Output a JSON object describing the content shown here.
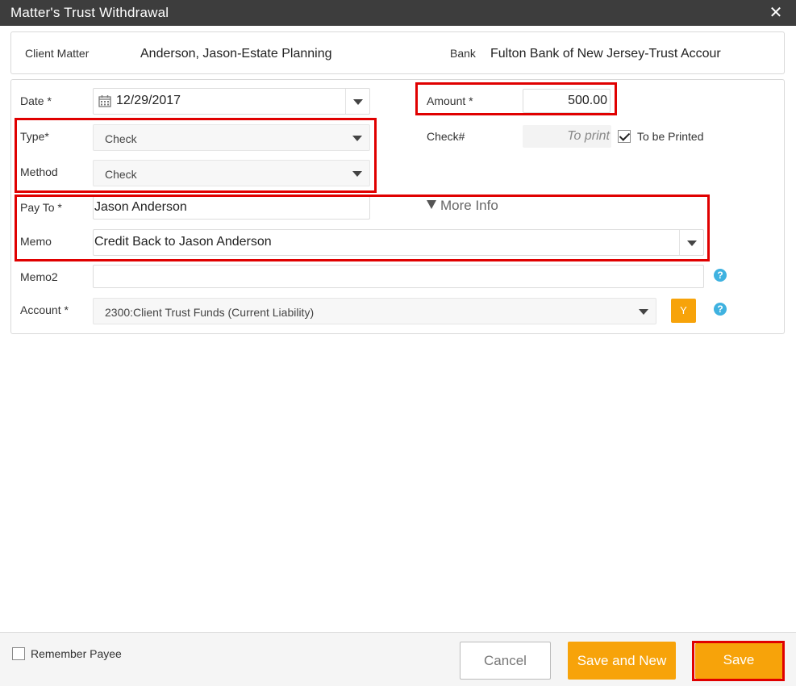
{
  "window": {
    "title": "Matter's Trust Withdrawal",
    "close_glyph": "✕"
  },
  "header": {
    "client_matter_label": "Client Matter",
    "client_matter_value": "Anderson, Jason-Estate Planning",
    "bank_label": "Bank",
    "bank_value": "Fulton Bank of New Jersey-Trust Accour"
  },
  "form": {
    "date_label": "Date *",
    "date_value": "12/29/2017",
    "amount_label": "Amount *",
    "amount_value": "500.00",
    "type_label": "Type*",
    "type_value": "Check",
    "check_label": "Check#",
    "check_placeholder": "To print",
    "to_be_printed_label": "To be Printed",
    "to_be_printed_checked": true,
    "method_label": "Method",
    "method_value": "Check",
    "payto_label": "Pay To *",
    "payto_value": "Jason Anderson",
    "more_info_label": "More Info",
    "memo_label": "Memo",
    "memo_value": "Credit Back to Jason Anderson",
    "memo2_label": "Memo2",
    "memo2_value": "",
    "account_label": "Account *",
    "account_value": "2300:Client Trust Funds (Current Liability)",
    "account_button_label": "Y",
    "help_glyph": "?"
  },
  "footer": {
    "remember_payee_label": "Remember Payee",
    "remember_payee_checked": false,
    "cancel_label": "Cancel",
    "save_new_label": "Save and New",
    "save_label": "Save"
  },
  "colors": {
    "titlebar": "#3d3d3d",
    "accent_orange": "#f7a30a",
    "highlight_red": "#e00000",
    "help_blue": "#3fb2e0"
  }
}
